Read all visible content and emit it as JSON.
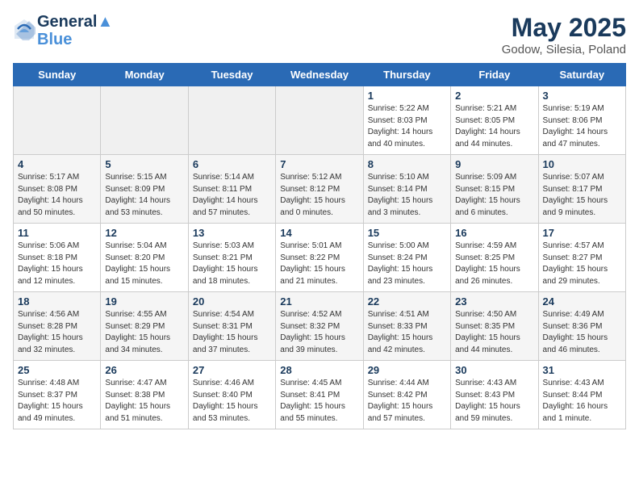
{
  "header": {
    "logo_line1": "General",
    "logo_line2": "Blue",
    "month": "May 2025",
    "location": "Godow, Silesia, Poland"
  },
  "weekdays": [
    "Sunday",
    "Monday",
    "Tuesday",
    "Wednesday",
    "Thursday",
    "Friday",
    "Saturday"
  ],
  "weeks": [
    [
      {
        "day": "",
        "empty": true
      },
      {
        "day": "",
        "empty": true
      },
      {
        "day": "",
        "empty": true
      },
      {
        "day": "",
        "empty": true
      },
      {
        "day": "1",
        "sunrise": "5:22 AM",
        "sunset": "8:03 PM",
        "daylight": "14 hours and 40 minutes."
      },
      {
        "day": "2",
        "sunrise": "5:21 AM",
        "sunset": "8:05 PM",
        "daylight": "14 hours and 44 minutes."
      },
      {
        "day": "3",
        "sunrise": "5:19 AM",
        "sunset": "8:06 PM",
        "daylight": "14 hours and 47 minutes."
      }
    ],
    [
      {
        "day": "4",
        "sunrise": "5:17 AM",
        "sunset": "8:08 PM",
        "daylight": "14 hours and 50 minutes."
      },
      {
        "day": "5",
        "sunrise": "5:15 AM",
        "sunset": "8:09 PM",
        "daylight": "14 hours and 53 minutes."
      },
      {
        "day": "6",
        "sunrise": "5:14 AM",
        "sunset": "8:11 PM",
        "daylight": "14 hours and 57 minutes."
      },
      {
        "day": "7",
        "sunrise": "5:12 AM",
        "sunset": "8:12 PM",
        "daylight": "15 hours and 0 minutes."
      },
      {
        "day": "8",
        "sunrise": "5:10 AM",
        "sunset": "8:14 PM",
        "daylight": "15 hours and 3 minutes."
      },
      {
        "day": "9",
        "sunrise": "5:09 AM",
        "sunset": "8:15 PM",
        "daylight": "15 hours and 6 minutes."
      },
      {
        "day": "10",
        "sunrise": "5:07 AM",
        "sunset": "8:17 PM",
        "daylight": "15 hours and 9 minutes."
      }
    ],
    [
      {
        "day": "11",
        "sunrise": "5:06 AM",
        "sunset": "8:18 PM",
        "daylight": "15 hours and 12 minutes."
      },
      {
        "day": "12",
        "sunrise": "5:04 AM",
        "sunset": "8:20 PM",
        "daylight": "15 hours and 15 minutes."
      },
      {
        "day": "13",
        "sunrise": "5:03 AM",
        "sunset": "8:21 PM",
        "daylight": "15 hours and 18 minutes."
      },
      {
        "day": "14",
        "sunrise": "5:01 AM",
        "sunset": "8:22 PM",
        "daylight": "15 hours and 21 minutes."
      },
      {
        "day": "15",
        "sunrise": "5:00 AM",
        "sunset": "8:24 PM",
        "daylight": "15 hours and 23 minutes."
      },
      {
        "day": "16",
        "sunrise": "4:59 AM",
        "sunset": "8:25 PM",
        "daylight": "15 hours and 26 minutes."
      },
      {
        "day": "17",
        "sunrise": "4:57 AM",
        "sunset": "8:27 PM",
        "daylight": "15 hours and 29 minutes."
      }
    ],
    [
      {
        "day": "18",
        "sunrise": "4:56 AM",
        "sunset": "8:28 PM",
        "daylight": "15 hours and 32 minutes."
      },
      {
        "day": "19",
        "sunrise": "4:55 AM",
        "sunset": "8:29 PM",
        "daylight": "15 hours and 34 minutes."
      },
      {
        "day": "20",
        "sunrise": "4:54 AM",
        "sunset": "8:31 PM",
        "daylight": "15 hours and 37 minutes."
      },
      {
        "day": "21",
        "sunrise": "4:52 AM",
        "sunset": "8:32 PM",
        "daylight": "15 hours and 39 minutes."
      },
      {
        "day": "22",
        "sunrise": "4:51 AM",
        "sunset": "8:33 PM",
        "daylight": "15 hours and 42 minutes."
      },
      {
        "day": "23",
        "sunrise": "4:50 AM",
        "sunset": "8:35 PM",
        "daylight": "15 hours and 44 minutes."
      },
      {
        "day": "24",
        "sunrise": "4:49 AM",
        "sunset": "8:36 PM",
        "daylight": "15 hours and 46 minutes."
      }
    ],
    [
      {
        "day": "25",
        "sunrise": "4:48 AM",
        "sunset": "8:37 PM",
        "daylight": "15 hours and 49 minutes."
      },
      {
        "day": "26",
        "sunrise": "4:47 AM",
        "sunset": "8:38 PM",
        "daylight": "15 hours and 51 minutes."
      },
      {
        "day": "27",
        "sunrise": "4:46 AM",
        "sunset": "8:40 PM",
        "daylight": "15 hours and 53 minutes."
      },
      {
        "day": "28",
        "sunrise": "4:45 AM",
        "sunset": "8:41 PM",
        "daylight": "15 hours and 55 minutes."
      },
      {
        "day": "29",
        "sunrise": "4:44 AM",
        "sunset": "8:42 PM",
        "daylight": "15 hours and 57 minutes."
      },
      {
        "day": "30",
        "sunrise": "4:43 AM",
        "sunset": "8:43 PM",
        "daylight": "15 hours and 59 minutes."
      },
      {
        "day": "31",
        "sunrise": "4:43 AM",
        "sunset": "8:44 PM",
        "daylight": "16 hours and 1 minute."
      }
    ]
  ]
}
